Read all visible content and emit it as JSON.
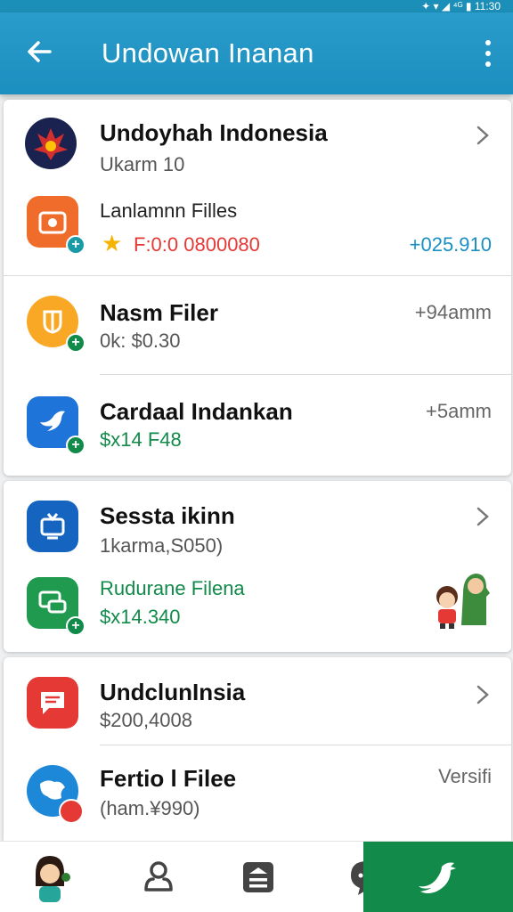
{
  "status": {
    "text": "✦ ▾ ◢ ⁴ᴳ ▮ 11:30"
  },
  "appbar": {
    "title": "Undowan Inanan"
  },
  "items": [
    {
      "title": "Undoyhah Indonesia",
      "sub": "Ukarm 10"
    },
    {
      "title": "Lanlamnn Filles",
      "sub": "F:0:0 0800080",
      "value": "+025.910"
    },
    {
      "title": "Nasm Filer",
      "sub": "0k: $0.30",
      "value": "+94amm"
    },
    {
      "title": "Cardaal Indankan",
      "sub": "$x14 F48",
      "value": "+5amm"
    },
    {
      "title": "Sessta ikinn",
      "sub": "1karma,S050)"
    },
    {
      "title": "Rudurane Filena",
      "sub": "$x14.340"
    },
    {
      "title": "UndclunInsia",
      "sub": "$200,4008"
    },
    {
      "title": "Fertio l Filee",
      "sub": "(ham.¥990)",
      "value": "Versifi"
    }
  ],
  "colors": {
    "primary": "#1b8fbf",
    "green": "#118a4a",
    "red": "#e53935",
    "blue_value": "#1a8fc2",
    "nav_active": "#118a4a"
  },
  "icons": {
    "item_0": "emblem-icon",
    "item_1": "photo-app-icon",
    "item_2": "yellow-app-icon",
    "item_3": "bird-app-icon",
    "item_4": "tv-app-icon",
    "item_5": "chat-app-icon",
    "item_6": "message-app-icon",
    "item_7": "map-app-icon"
  }
}
